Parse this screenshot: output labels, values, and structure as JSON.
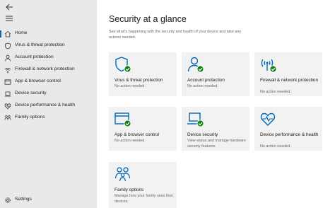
{
  "colors": {
    "accent": "#0067b8",
    "ok": "#107c10",
    "sidebar_bg": "#e9e9e9",
    "tile_bg": "#f2f2f2"
  },
  "sidebar": {
    "items": [
      {
        "label": "Home",
        "icon": "home-icon"
      },
      {
        "label": "Virus & threat protection",
        "icon": "shield-icon"
      },
      {
        "label": "Account protection",
        "icon": "person-icon"
      },
      {
        "label": "Firewall & network protection",
        "icon": "wifi-icon"
      },
      {
        "label": "App & browser control",
        "icon": "app-window-icon"
      },
      {
        "label": "Device security",
        "icon": "laptop-icon"
      },
      {
        "label": "Device performance & health",
        "icon": "heart-icon"
      },
      {
        "label": "Family options",
        "icon": "family-icon"
      }
    ],
    "settings_label": "Settings"
  },
  "main": {
    "title": "Security at a glance",
    "subtitle": "See what's happening with the security and health of your device and take any actions needed.",
    "tiles": [
      {
        "title": "Virus & threat protection",
        "desc": "No action needed.",
        "icon": "shield-icon"
      },
      {
        "title": "Account protection",
        "desc": "No action needed.",
        "icon": "person-icon"
      },
      {
        "title": "Firewall & network protection",
        "desc": "No action needed.",
        "icon": "wifi-icon"
      },
      {
        "title": "App & browser control",
        "desc": "No action needed.",
        "icon": "app-window-icon"
      },
      {
        "title": "Device security",
        "desc": "View status and manage hardware security features",
        "icon": "laptop-icon"
      },
      {
        "title": "Device performance & health",
        "desc": "No action needed.",
        "icon": "heart-icon"
      },
      {
        "title": "Family options",
        "desc": "Manage how your family uses their devices.",
        "icon": "family-icon"
      }
    ]
  }
}
